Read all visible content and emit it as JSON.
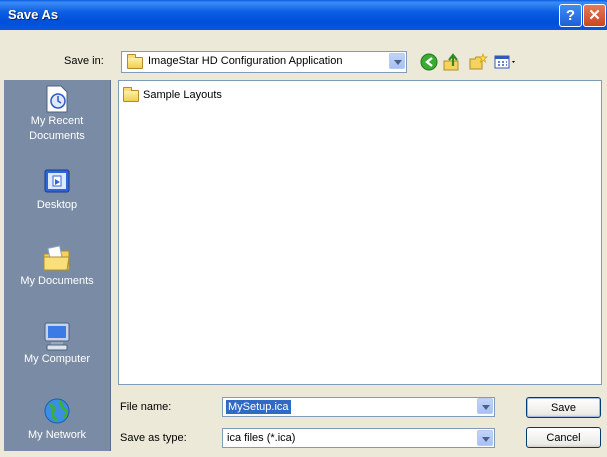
{
  "window": {
    "title": "Save As"
  },
  "titlebar": {
    "help_label": "?",
    "close_label": "✕"
  },
  "toolbar": {
    "save_in_label": "Save in:",
    "save_in_value": "ImageStar HD Configuration Application",
    "icons": [
      "back-icon",
      "up-folder-icon",
      "new-folder-icon",
      "views-menu-icon"
    ]
  },
  "places": [
    {
      "label": "My Recent Documents",
      "icon": "recent-documents-icon"
    },
    {
      "label": "Desktop",
      "icon": "desktop-icon"
    },
    {
      "label": "My Documents",
      "icon": "my-documents-icon"
    },
    {
      "label": "My Computer",
      "icon": "my-computer-icon"
    },
    {
      "label": "My Network",
      "icon": "my-network-icon"
    }
  ],
  "files": [
    {
      "name": "Sample Layouts",
      "type": "folder"
    }
  ],
  "form": {
    "file_name_label": "File name:",
    "file_name_value": "MySetup.ica",
    "save_as_type_label": "Save as type:",
    "save_as_type_value": "ica files (*.ica)"
  },
  "buttons": {
    "save": "Save",
    "cancel": "Cancel"
  },
  "colors": {
    "title_bar": "#0a54e0",
    "places_bar": "#7a8ba5",
    "selection": "#316ac5",
    "dialog_bg": "#ece9d8"
  }
}
